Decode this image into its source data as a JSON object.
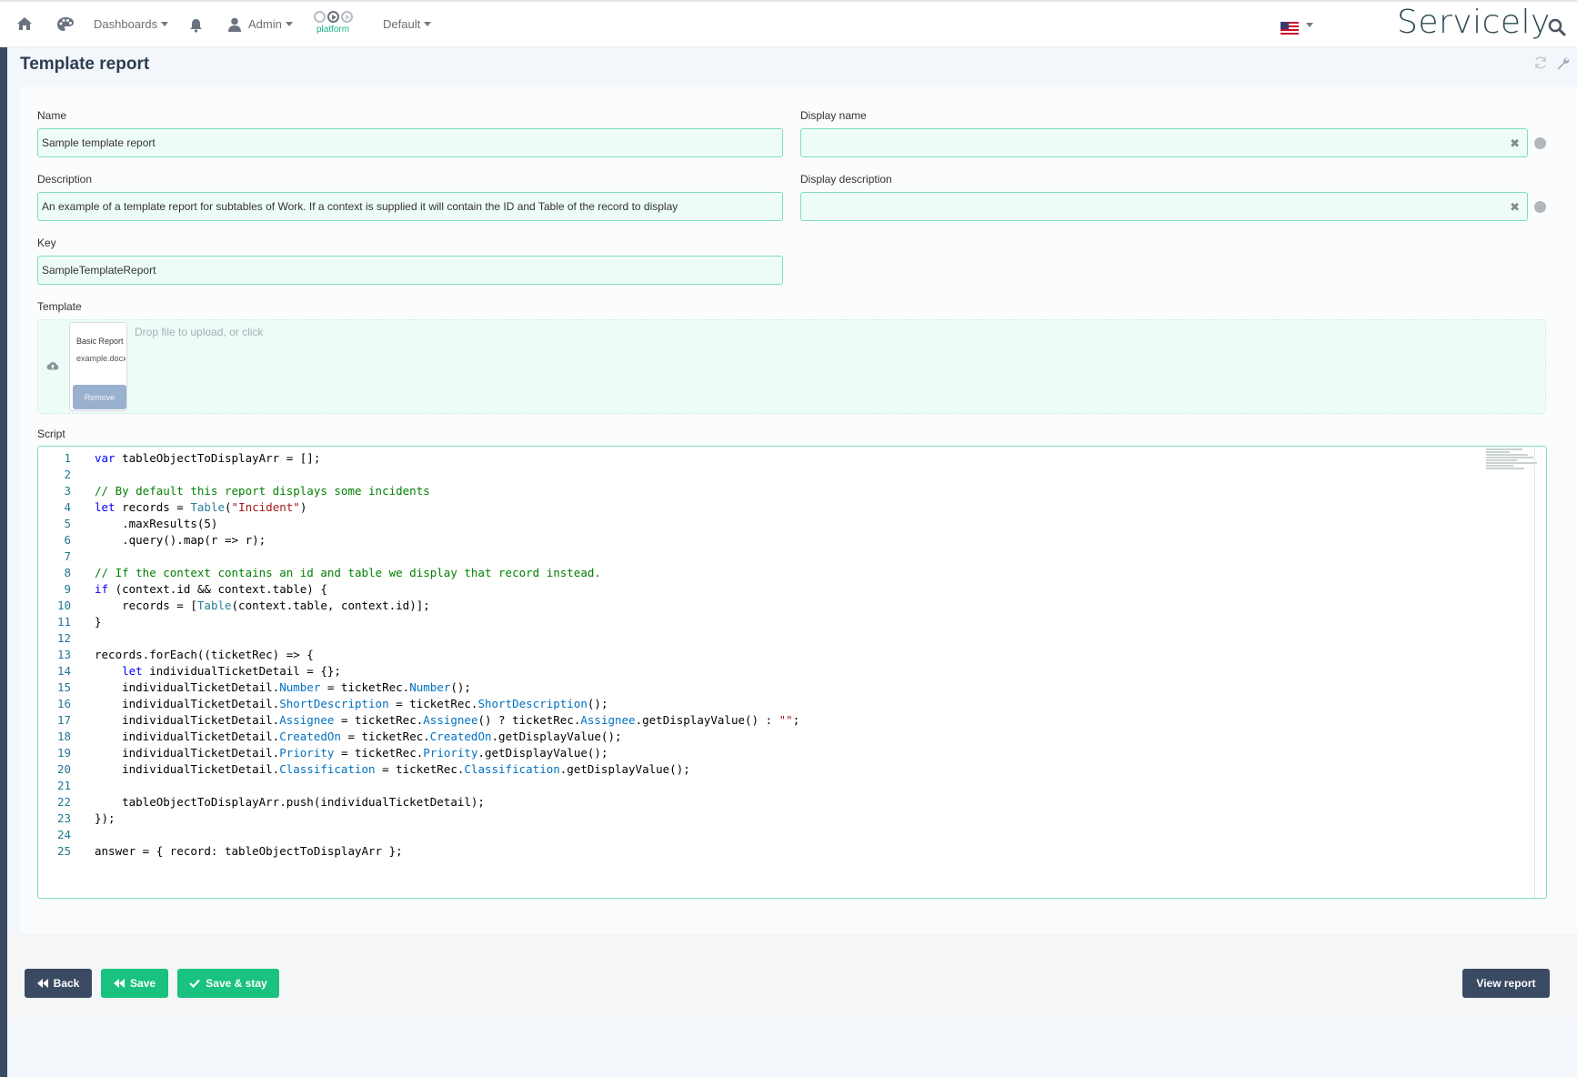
{
  "nav": {
    "dashboards_label": "Dashboards",
    "admin_label": "Admin",
    "platform_label": "platform",
    "default_label": "Default",
    "logo_text": "Servicely",
    "icons": [
      "home-icon",
      "palette-icon",
      "bell-icon",
      "user-icon",
      "play-icon",
      "us-flag-icon",
      "search-icon"
    ]
  },
  "page": {
    "title": "Template report"
  },
  "form": {
    "name_label": "Name",
    "name_value": "Sample template report",
    "display_name_label": "Display name",
    "display_name_value": "",
    "description_label": "Description",
    "description_value": "An example of a template report for subtables of Work. If a context is supplied it will contain the ID and Table of the record to display",
    "display_description_label": "Display description",
    "display_description_value": "",
    "key_label": "Key",
    "key_value": "SampleTemplateReport",
    "template_label": "Template",
    "dropzone_text": "Drop file to upload, or click",
    "file_name": "Basic Report",
    "file_sub": "example.docx",
    "remove_label": "Remove",
    "script_label": "Script",
    "clear_symbol": "✖"
  },
  "script_lines": [
    "var tableObjectToDisplayArr = [];",
    "",
    "// By default this report displays some incidents",
    "let records = Table(\"Incident\")",
    "    .maxResults(5)",
    "    .query().map(r => r);",
    "",
    "// If the context contains an id and table we display that record instead.",
    "if (context.id && context.table) {",
    "    records = [Table(context.table, context.id)];",
    "}",
    "",
    "records.forEach((ticketRec) => {",
    "    let individualTicketDetail = {};",
    "    individualTicketDetail.Number = ticketRec.Number();",
    "    individualTicketDetail.ShortDescription = ticketRec.ShortDescription();",
    "    individualTicketDetail.Assignee = ticketRec.Assignee() ? ticketRec.Assignee.getDisplayValue() : \"\";",
    "    individualTicketDetail.CreatedOn = ticketRec.CreatedOn.getDisplayValue();",
    "    individualTicketDetail.Priority = ticketRec.Priority.getDisplayValue();",
    "    individualTicketDetail.Classification = ticketRec.Classification.getDisplayValue();",
    "",
    "    tableObjectToDisplayArr.push(individualTicketDetail);",
    "});",
    "",
    "answer = { record: tableObjectToDisplayArr };"
  ],
  "footer": {
    "back_label": "Back",
    "save_label": "Save",
    "save_stay_label": "Save & stay",
    "view_report_label": "View report"
  },
  "colors": {
    "accent_green": "#19c27e",
    "dark_button": "#3b4a63",
    "input_bg": "#eefcf8",
    "input_border": "#7fdcc0"
  }
}
